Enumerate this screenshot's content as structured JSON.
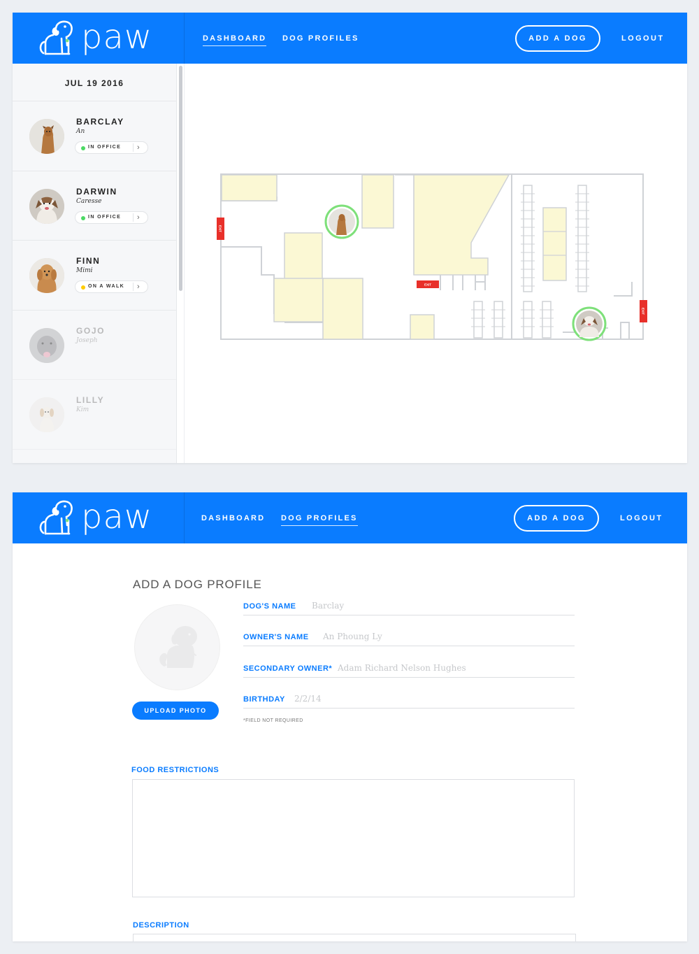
{
  "brand": {
    "name": "paw"
  },
  "nav": {
    "dashboard": "DASHBOARD",
    "dog_profiles": "DOG PROFILES",
    "add_dog": "ADD A DOG",
    "logout": "LOGOUT"
  },
  "dashboard": {
    "date": "JUL 19 2016",
    "dogs": [
      {
        "name": "BARCLAY",
        "owner": "An",
        "status": "IN OFFICE",
        "status_color": "#4cd964"
      },
      {
        "name": "DARWIN",
        "owner": "Caresse",
        "status": "IN OFFICE",
        "status_color": "#4cd964"
      },
      {
        "name": "FINN",
        "owner": "Mimi",
        "status": "ON A WALK",
        "status_color": "#ffcc00"
      },
      {
        "name": "GOJO",
        "owner": "Joseph"
      },
      {
        "name": "LILLY",
        "owner": "Kim"
      }
    ],
    "map": {
      "exit_label": "EXIT",
      "room_fill": "#fbf8d4",
      "exit_color": "#e8302a",
      "marker_color": "#7ee07a"
    }
  },
  "profile_form": {
    "title": "ADD A DOG PROFILE",
    "upload_label": "UPLOAD PHOTO",
    "fields": [
      {
        "label": "DOG'S NAME",
        "value": "Barclay"
      },
      {
        "label": "OWNER'S NAME",
        "value": "An Phoung Ly"
      },
      {
        "label": "SECONDARY OWNER*",
        "value": "Adam Richard Nelson Hughes"
      },
      {
        "label": "BIRTHDAY",
        "value": "2/2/14"
      }
    ],
    "note": "*FIELD NOT REQUIRED",
    "food_label": "FOOD RESTRICTIONS",
    "description_label": "DESCRIPTION"
  },
  "colors": {
    "accent": "#0a7cff"
  }
}
